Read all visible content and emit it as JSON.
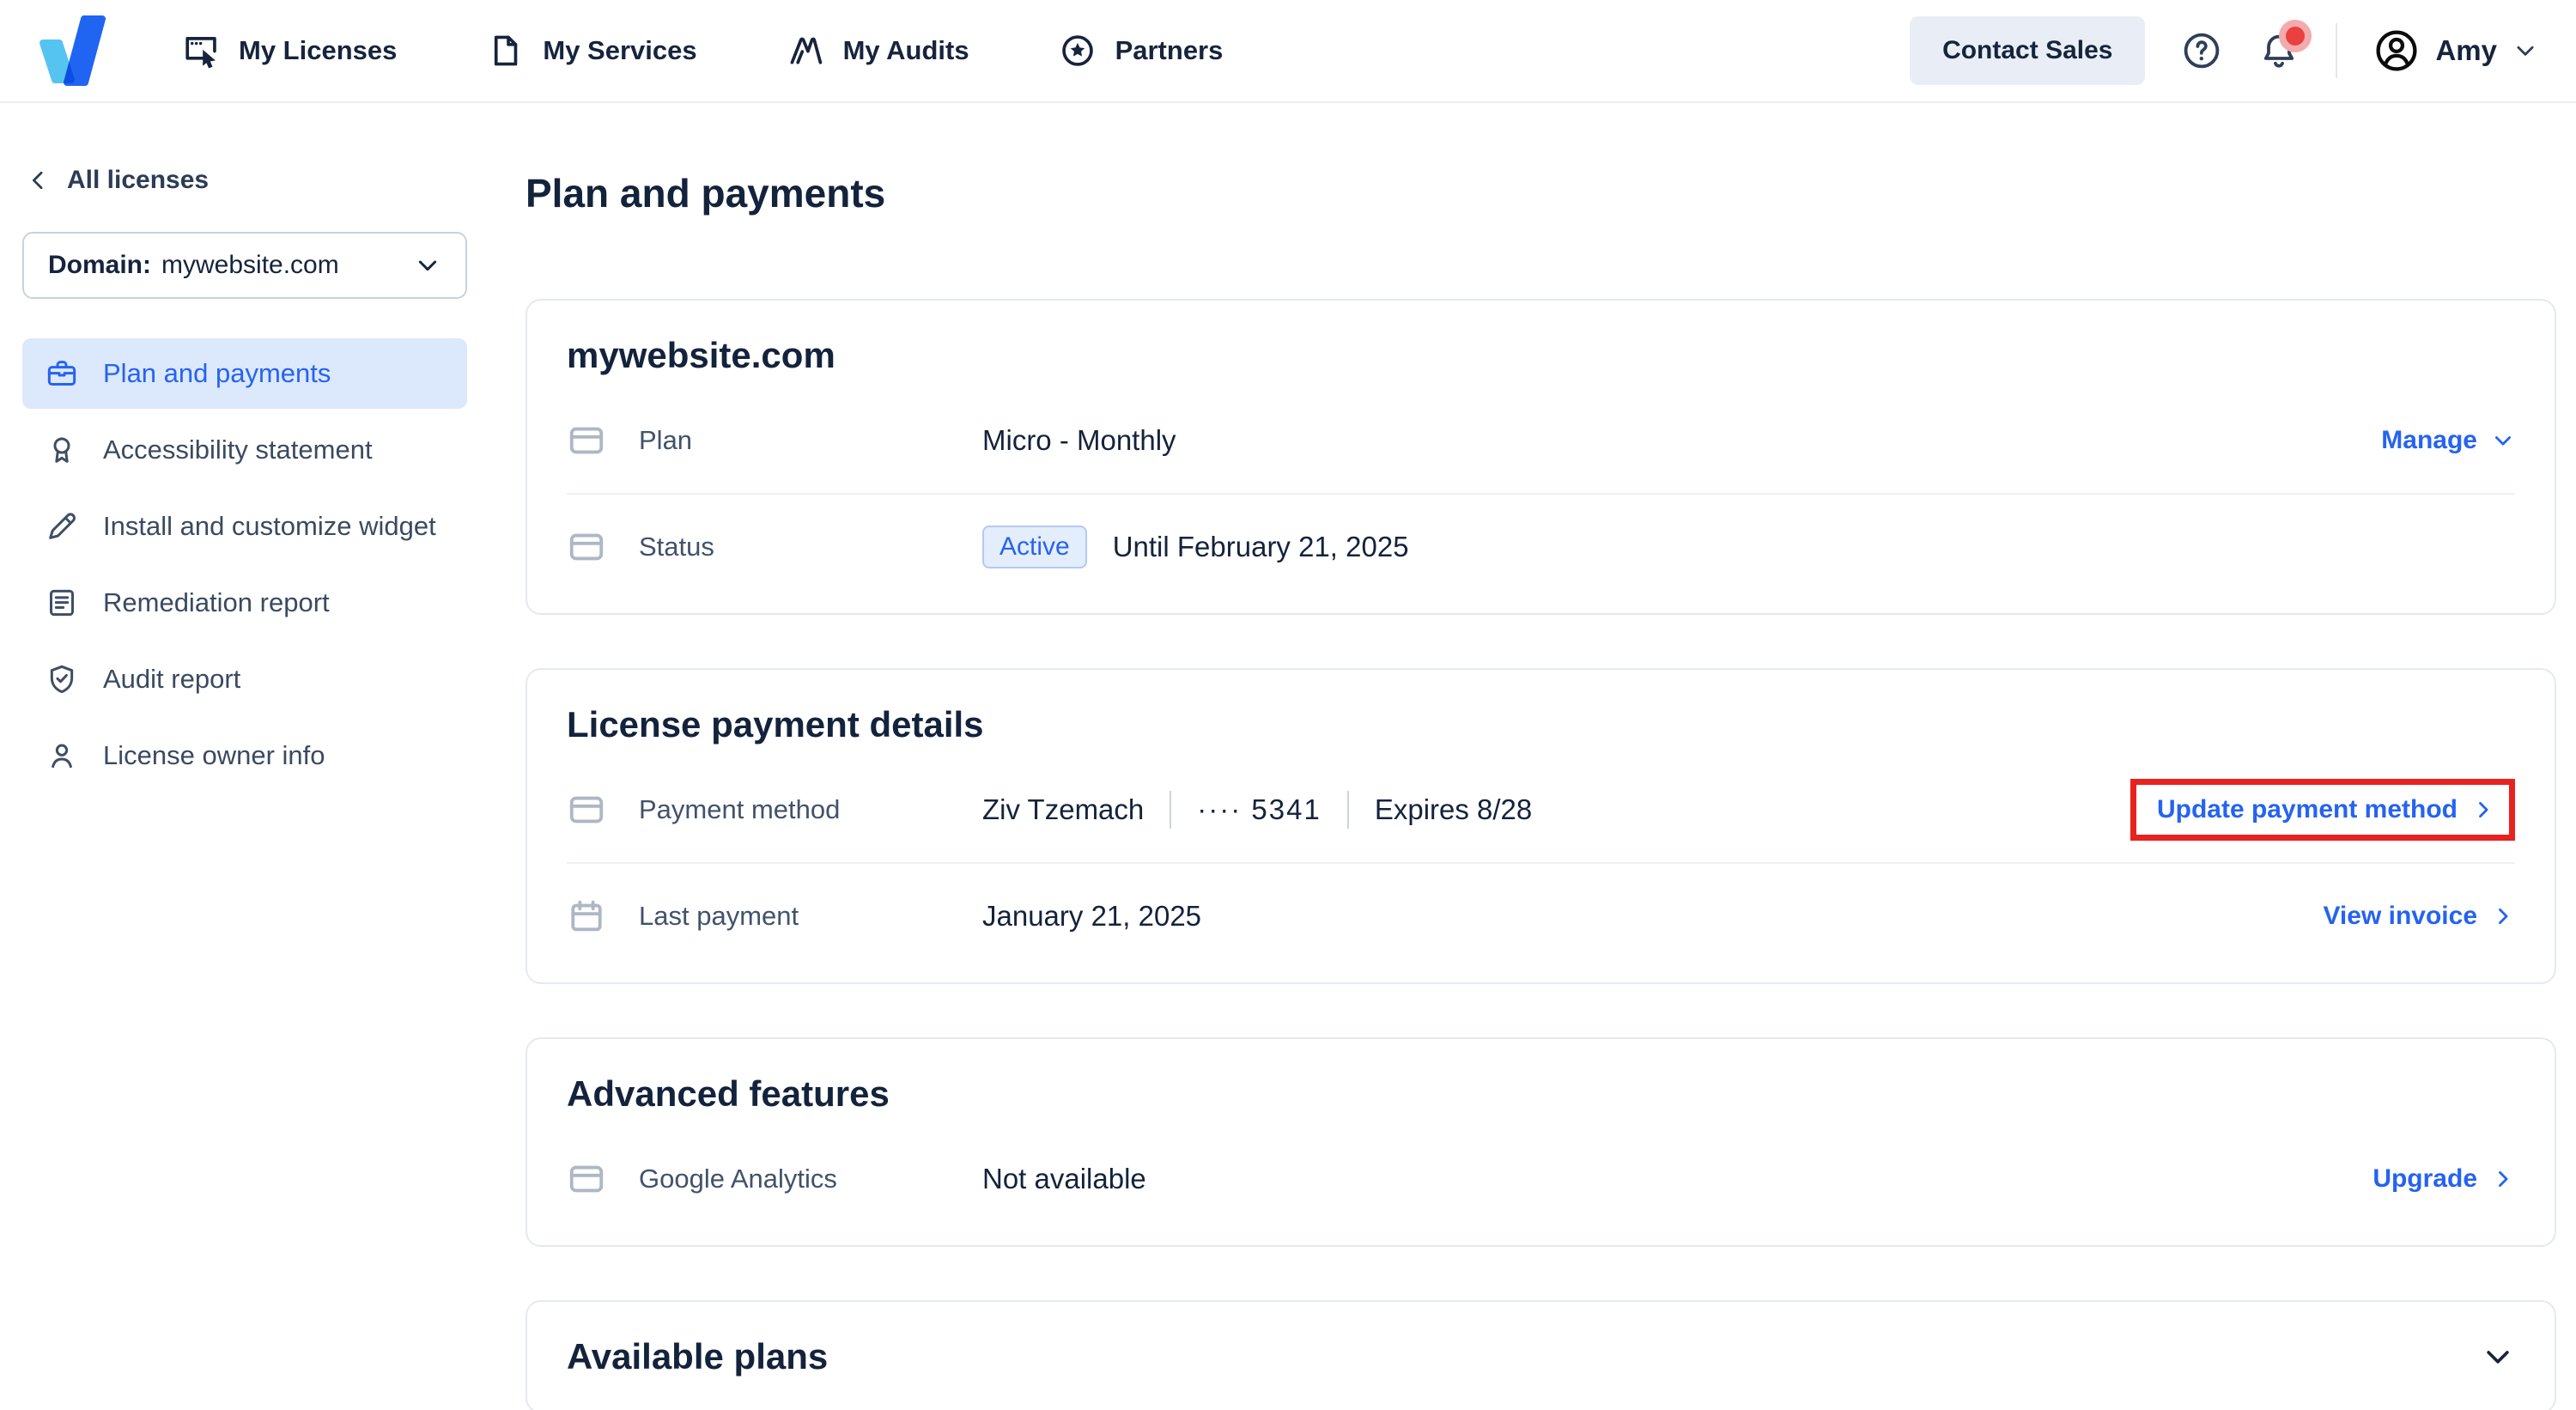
{
  "colors": {
    "accent_blue": "#2563f0",
    "navy_text": "#16243d",
    "label_slate": "#42526b",
    "annotation_red": "#e8221f",
    "sidebar_active_bg": "#dce8fc",
    "badge_bg": "#e4edfc",
    "logo_light_blue": "#56c4f1",
    "logo_blue": "#2065f2",
    "notification_dot_red": "#e8413f"
  },
  "header": {
    "nav_items": [
      {
        "label": "My Licenses"
      },
      {
        "label": "My Services"
      },
      {
        "label": "My Audits"
      },
      {
        "label": "Partners"
      }
    ],
    "contact_sales_label": "Contact Sales",
    "user_name": "Amy"
  },
  "sidebar": {
    "back_label": "All licenses",
    "domain_prefix": "Domain:",
    "domain_value": "mywebsite.com",
    "items": [
      {
        "label": "Plan and payments",
        "active": true
      },
      {
        "label": "Accessibility statement",
        "active": false
      },
      {
        "label": "Install and customize widget",
        "active": false
      },
      {
        "label": "Remediation report",
        "active": false
      },
      {
        "label": "Audit report",
        "active": false
      },
      {
        "label": "License owner info",
        "active": false
      }
    ]
  },
  "main": {
    "page_title": "Plan and payments",
    "domain_card": {
      "title": "mywebsite.com",
      "plan_label": "Plan",
      "plan_value": "Micro - Monthly",
      "manage_label": "Manage",
      "status_label": "Status",
      "status_badge": "Active",
      "status_until": "Until February 21, 2025"
    },
    "payment_card": {
      "title": "License payment details",
      "method_label": "Payment method",
      "method_name": "Ziv Tzemach",
      "method_card": "···· 5341",
      "method_expires": "Expires 8/28",
      "update_label": "Update payment method",
      "last_payment_label": "Last payment",
      "last_payment_value": "January 21, 2025",
      "view_invoice_label": "View invoice"
    },
    "features_card": {
      "title": "Advanced features",
      "ga_label": "Google Analytics",
      "ga_value": "Not available",
      "upgrade_label": "Upgrade"
    },
    "plans_card": {
      "title": "Available plans"
    }
  }
}
